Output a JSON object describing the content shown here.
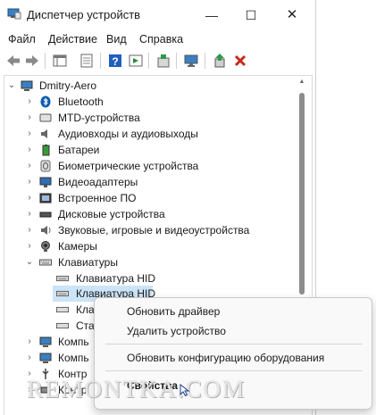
{
  "window": {
    "title": "Диспетчер устройств",
    "min_glyph": "—",
    "max_glyph": "☐",
    "close_glyph": "✕"
  },
  "menu": [
    "Файл",
    "Действие",
    "Вид",
    "Справка"
  ],
  "toolbar_icons": [
    "back-arrow-icon",
    "forward-arrow-icon",
    "show-hide-tree-icon",
    "properties-sheet-icon",
    "help-icon",
    "action-pane-icon",
    "scan-hardware-icon",
    "monitor-icon",
    "update-driver-icon",
    "remove-device-icon"
  ],
  "tree": {
    "root": "Dmitry-Aero",
    "categories": [
      {
        "label": "Bluetooth",
        "icon": "bluetooth-icon",
        "expanded": false
      },
      {
        "label": "MTD-устройства",
        "icon": "mtd-device-icon",
        "expanded": false
      },
      {
        "label": "Аудиовходы и аудиовыходы",
        "icon": "speaker-icon",
        "expanded": false
      },
      {
        "label": "Батареи",
        "icon": "battery-icon",
        "expanded": false
      },
      {
        "label": "Биометрические устройства",
        "icon": "fingerprint-icon",
        "expanded": false
      },
      {
        "label": "Видеоадаптеры",
        "icon": "display-adapter-icon",
        "expanded": false
      },
      {
        "label": "Встроенное ПО",
        "icon": "firmware-icon",
        "expanded": false
      },
      {
        "label": "Дисковые устройства",
        "icon": "disk-drive-icon",
        "expanded": false
      },
      {
        "label": "Звуковые, игровые и видеоустройства",
        "icon": "sound-device-icon",
        "expanded": false
      },
      {
        "label": "Камеры",
        "icon": "camera-icon",
        "expanded": false
      },
      {
        "label": "Клавиатуры",
        "icon": "keyboard-icon",
        "expanded": true
      }
    ],
    "keyboards": [
      "Клавиатура HID",
      "Клавиатура HID",
      "Кла",
      "Ста"
    ],
    "below": [
      "Компь",
      "Компь",
      "Контр",
      "Контр"
    ]
  },
  "context_menu": {
    "items": [
      "Обновить драйвер",
      "Удалить устройство",
      "Обновить конфигурацию оборудования",
      "Свойства"
    ],
    "bold_item": "Свойства"
  },
  "watermark": "REMONTKA.COM",
  "colors": {
    "selection": "#cce4f7",
    "remove_red": "#c42b1c",
    "bluetooth_blue": "#0b5cad",
    "help_blue": "#1f5fbf"
  }
}
